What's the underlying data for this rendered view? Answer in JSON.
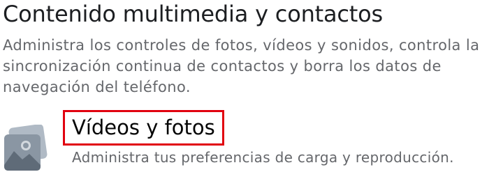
{
  "section": {
    "title": "Contenido multimedia y contactos",
    "description": "Administra los controles de fotos, vídeos y sonidos, controla la sincronización continua de contactos y borra los datos de navegación del teléfono."
  },
  "items": [
    {
      "icon": "photos-icon",
      "title": "Vídeos y fotos",
      "subtitle": "Administra tus preferencias de carga y reproducción."
    }
  ],
  "colors": {
    "highlight_border": "#e1000f",
    "icon_front": "#8a96a3",
    "icon_back": "#b0bac5",
    "secondary_text": "#65676b"
  }
}
